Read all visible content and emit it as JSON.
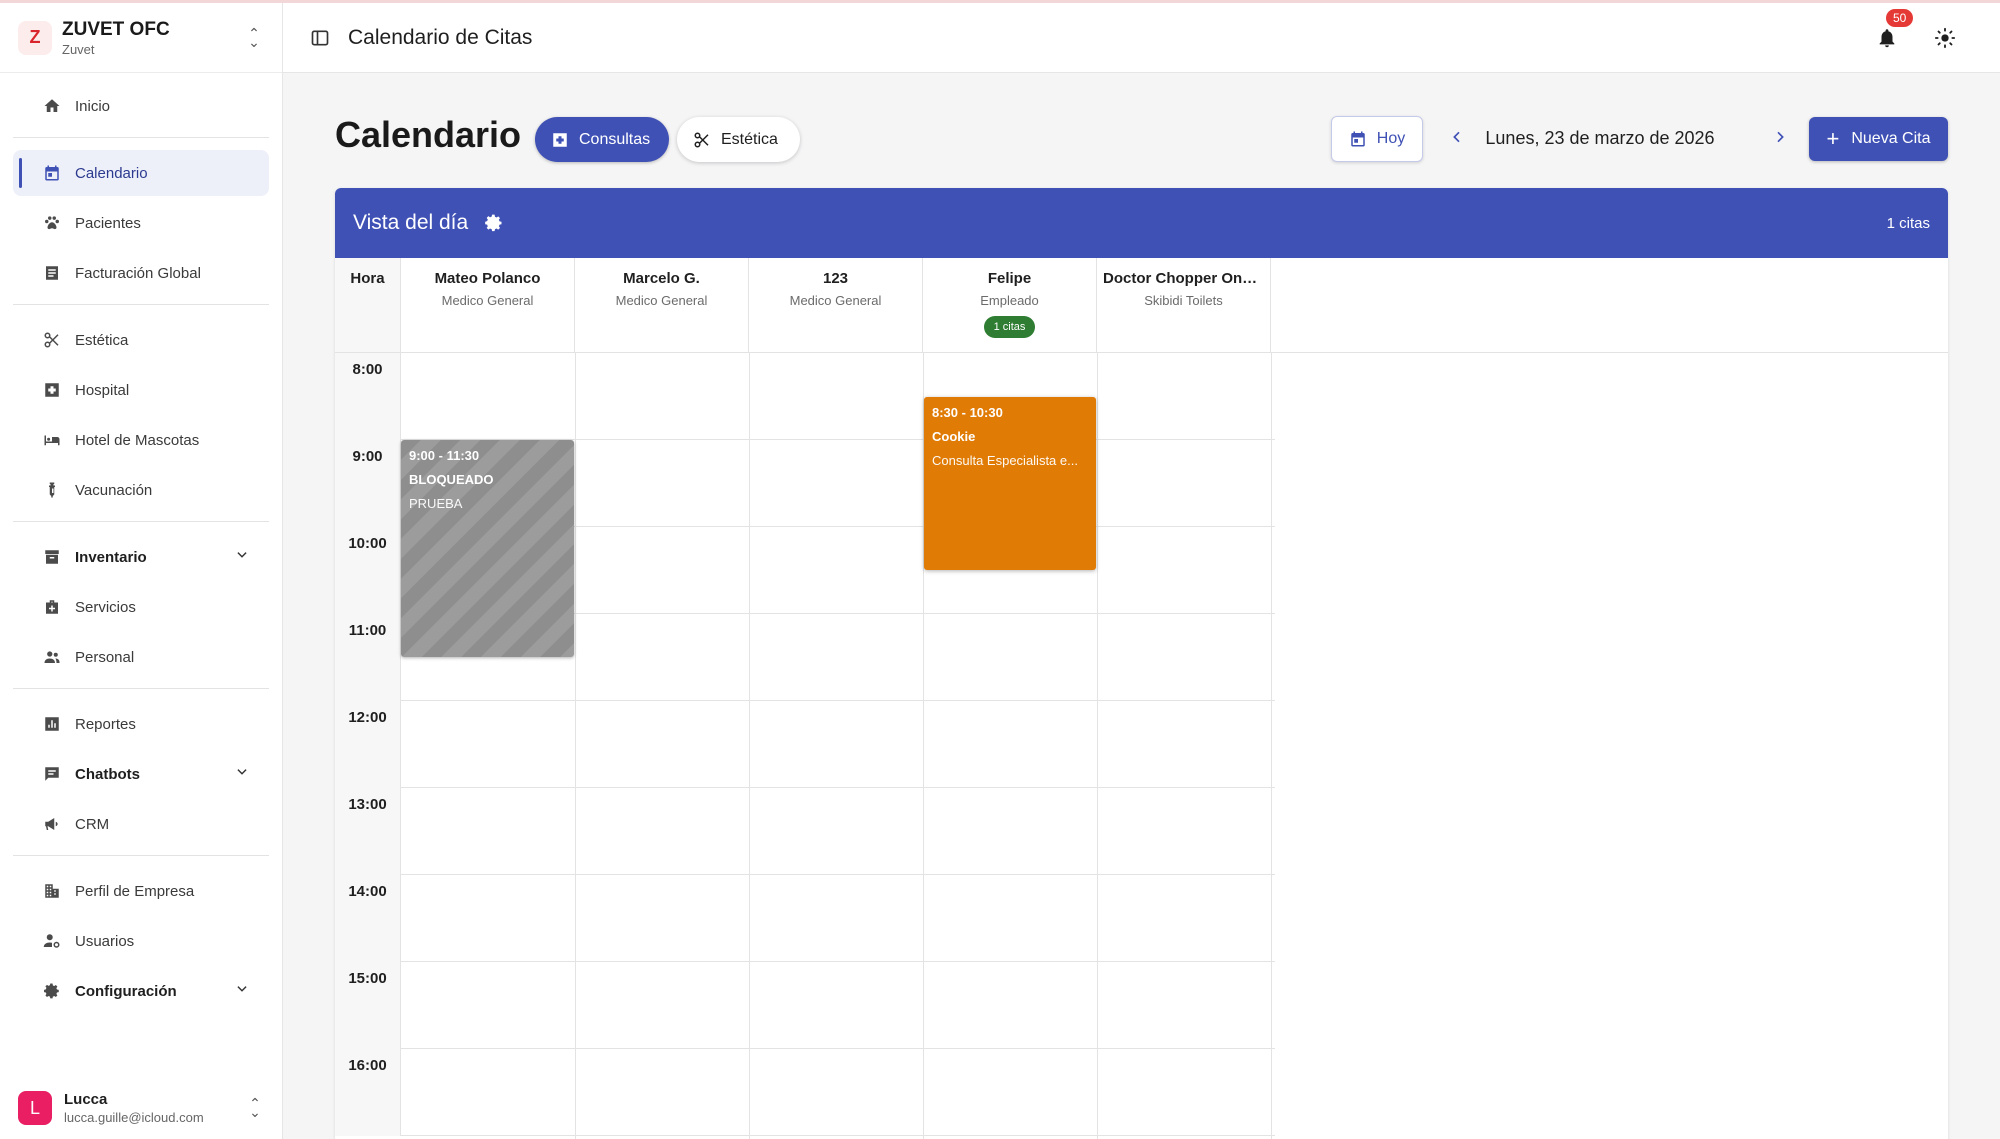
{
  "brand": {
    "name": "ZUVET OFC",
    "sub": "Zuvet",
    "logo_letter": "Z"
  },
  "sidebar": {
    "items": [
      {
        "label": "Inicio",
        "icon": "home-icon"
      },
      {
        "label": "Calendario",
        "icon": "calendar-icon"
      },
      {
        "label": "Pacientes",
        "icon": "paw-icon"
      },
      {
        "label": "Facturación Global",
        "icon": "invoice-icon"
      },
      {
        "label": "Estética",
        "icon": "scissors-icon"
      },
      {
        "label": "Hospital",
        "icon": "hospital-icon"
      },
      {
        "label": "Hotel de Mascotas",
        "icon": "bed-icon"
      },
      {
        "label": "Vacunación",
        "icon": "vaccine-icon"
      },
      {
        "label": "Inventario",
        "icon": "archive-icon"
      },
      {
        "label": "Servicios",
        "icon": "medical-bag-icon"
      },
      {
        "label": "Personal",
        "icon": "people-icon"
      },
      {
        "label": "Reportes",
        "icon": "bar-chart-icon"
      },
      {
        "label": "Chatbots",
        "icon": "chat-icon"
      },
      {
        "label": "CRM",
        "icon": "megaphone-icon"
      },
      {
        "label": "Perfil de Empresa",
        "icon": "building-icon"
      },
      {
        "label": "Usuarios",
        "icon": "user-gear-icon"
      },
      {
        "label": "Configuración",
        "icon": "gear-icon"
      }
    ],
    "active": "Calendario"
  },
  "user": {
    "initial": "L",
    "name": "Lucca",
    "email": "lucca.guille@icloud.com"
  },
  "header": {
    "title": "Calendario de Citas",
    "notifications": "50"
  },
  "main": {
    "title": "Calendario",
    "tabs": [
      {
        "label": "Consultas"
      },
      {
        "label": "Estética"
      }
    ],
    "today_label": "Hoy",
    "date": "Lunes, 23 de marzo de 2026",
    "new_label": "Nueva Cita"
  },
  "calendar": {
    "title": "Vista del día",
    "count": "1 citas",
    "hour_header": "Hora",
    "hours": [
      "8:00",
      "9:00",
      "10:00",
      "11:00",
      "12:00",
      "13:00",
      "14:00",
      "15:00",
      "16:00"
    ],
    "columns": [
      {
        "name": "Mateo Polanco",
        "role": "Medico General",
        "badge": ""
      },
      {
        "name": "Marcelo G.",
        "role": "Medico General",
        "badge": ""
      },
      {
        "name": "123",
        "role": "Medico General",
        "badge": ""
      },
      {
        "name": "Felipe",
        "role": "Empleado",
        "badge": "1 citas"
      },
      {
        "name": "Doctor Chopper One ...",
        "role": "Skibidi Toilets",
        "badge": ""
      }
    ],
    "events": [
      {
        "time": "9:00 - 11:30",
        "title": "BLOQUEADO",
        "subtitle": "PRUEBA",
        "color": "#8e8e8e"
      },
      {
        "time": "8:30 - 10:30",
        "title": "Cookie",
        "subtitle": "Consulta Especialista e...",
        "color": "#e07b06"
      }
    ]
  },
  "colors": {
    "primary": "#3f51b5",
    "success": "#2e7d32",
    "accent_orange": "#e07b06",
    "danger": "#e53935"
  }
}
